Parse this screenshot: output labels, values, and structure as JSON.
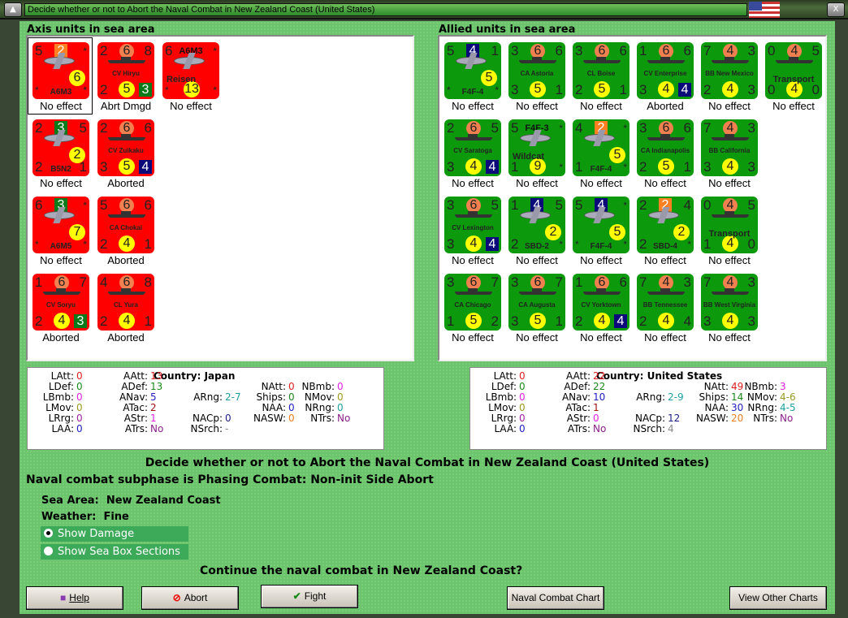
{
  "window": {
    "title": "Decide whether or not to Abort the Naval Combat in New Zealand Coast (United States)",
    "min_glyph": "▲",
    "close_glyph": "X"
  },
  "axis": {
    "header": "Axis units in sea area",
    "units": [
      {
        "kind": "plane",
        "tl": "5",
        "top": "2",
        "top_style": "sq-orange",
        "tr": "*",
        "mid": "6",
        "bl": "*",
        "br": "*",
        "name": "A6M3",
        "status": "No effect",
        "selected": true
      },
      {
        "kind": "ship",
        "tl": "2",
        "top": "6",
        "top_style": "circle",
        "tr": "8",
        "bl": "2",
        "bc": "5",
        "br": "3",
        "br_style": "sq-green",
        "name": "CV Hiryu",
        "status": "Abrt Dmgd"
      },
      {
        "kind": "plane",
        "tl": "6",
        "top": "A6M3",
        "top_style": "text",
        "tr": "*",
        "bc": "13",
        "bl": "*",
        "br": "*",
        "extra": "Reisen",
        "status": "No effect"
      },
      {
        "kind": "plane",
        "tl": "2",
        "top": "3",
        "top_style": "sq-green",
        "tr": "5",
        "mid": "2",
        "bl": "2",
        "br": "1",
        "name": "B5N2",
        "status": "No effect"
      },
      {
        "kind": "ship",
        "tl": "2",
        "top": "6",
        "top_style": "circle",
        "tr": "6",
        "bl": "3",
        "bc": "5",
        "br": "4",
        "br_style": "sq-blue",
        "name": "CV Zuikaku",
        "status": "Aborted"
      },
      {
        "kind": "plane",
        "tl": "6",
        "top": "3",
        "top_style": "sq-green",
        "tr": "*",
        "mid": "7",
        "bl": "*",
        "br": "*",
        "name": "A6M5",
        "status": "No effect"
      },
      {
        "kind": "ship",
        "tl": "5",
        "top": "6",
        "top_style": "circle",
        "tr": "6",
        "bl": "2",
        "bc": "4",
        "br": "1",
        "name": "CA Chokai",
        "status": "Aborted"
      },
      {
        "kind": "ship",
        "tl": "1",
        "top": "6",
        "top_style": "circle",
        "tr": "7",
        "bl": "2",
        "bc": "4",
        "br": "3",
        "br_style": "sq-green",
        "name": "CV Soryu",
        "status": "Aborted"
      },
      {
        "kind": "ship",
        "tl": "4",
        "top": "6",
        "top_style": "circle",
        "tr": "8",
        "bl": "2",
        "bc": "4",
        "br": "1",
        "name": "CL Yura",
        "status": "Aborted"
      }
    ],
    "stats": {
      "country_label": "Country:",
      "country": "Japan",
      "LAtt": "0",
      "LDef": "0",
      "LBmb": "0",
      "LMov": "0",
      "LRrg": "0",
      "LAA": "0",
      "AAtt": "13",
      "ADef": "13",
      "ANav": "5",
      "ATac": "2",
      "AStr": "1",
      "ATrs": "No",
      "ARng": "2-7",
      "NACp": "0",
      "NSrch": "-",
      "NAtt": "0",
      "Ships": "0",
      "NAA": "0",
      "NASW": "0",
      "NBmb": "0",
      "NMov": "0",
      "NRng": "0",
      "NTrs": "No"
    }
  },
  "allied": {
    "header": "Allied units in sea area",
    "units": [
      {
        "kind": "plane",
        "tl": "5",
        "top": "4",
        "top_style": "sq-blue",
        "tr": "1",
        "mid": "5",
        "bl": "*",
        "br": "*",
        "name": "F4F-4",
        "status": "No effect"
      },
      {
        "kind": "ship",
        "tl": "3",
        "top": "6",
        "top_style": "circle",
        "tr": "6",
        "bl": "3",
        "bc": "5",
        "br": "1",
        "name": "CA Astoria",
        "status": "No effect"
      },
      {
        "kind": "ship",
        "tl": "3",
        "top": "6",
        "top_style": "circle",
        "tr": "6",
        "bl": "2",
        "bc": "5",
        "br": "1",
        "name": "CL Boise",
        "status": "No effect"
      },
      {
        "kind": "ship",
        "tl": "1",
        "top": "6",
        "top_style": "circle",
        "tr": "6",
        "bl": "3",
        "bc": "4",
        "br": "4",
        "br_style": "sq-blue",
        "name": "CV Enterprise",
        "status": "Aborted"
      },
      {
        "kind": "ship",
        "tl": "7",
        "top": "4",
        "top_style": "circle",
        "tr": "3",
        "bl": "2",
        "bc": "4",
        "br": "3",
        "name": "BB New Mexico",
        "status": "No effect"
      },
      {
        "kind": "ship",
        "tl": "0",
        "top": "4",
        "top_style": "circle",
        "tr": "5",
        "bl": "0",
        "bc": "4",
        "br": "0",
        "extra": "Transport",
        "status": "No effect"
      },
      {
        "kind": "ship",
        "tl": "2",
        "top": "6",
        "top_style": "circle",
        "tr": "5",
        "bl": "3",
        "bc": "4",
        "br": "4",
        "br_style": "sq-blue",
        "name": "CV Saratoga",
        "status": "No effect"
      },
      {
        "kind": "plane",
        "tl": "5",
        "top": "F4F-3",
        "top_style": "text",
        "tr": "*",
        "bl": "1",
        "bc": "9",
        "br": "*",
        "extra": "Wildcat",
        "status": "No effect"
      },
      {
        "kind": "plane",
        "tl": "4",
        "top": "2",
        "top_style": "sq-orange",
        "tr": "*",
        "mid": "5",
        "bl": "1",
        "br": "*",
        "name": "F4F-4",
        "status": "No effect"
      },
      {
        "kind": "ship",
        "tl": "3",
        "top": "6",
        "top_style": "circle",
        "tr": "6",
        "bl": "2",
        "bc": "5",
        "br": "1",
        "name": "CA Indianapolis",
        "status": "No effect"
      },
      {
        "kind": "ship",
        "tl": "7",
        "top": "4",
        "top_style": "circle",
        "tr": "3",
        "bl": "3",
        "bc": "4",
        "br": "3",
        "name": "BB California",
        "status": "No effect"
      },
      {
        "kind": "ship",
        "tl": "3",
        "top": "6",
        "top_style": "circle",
        "tr": "5",
        "bl": "3",
        "bc": "4",
        "br": "4",
        "br_style": "sq-blue",
        "name": "CV Lexington",
        "status": "No effect"
      },
      {
        "kind": "plane",
        "tl": "1",
        "top": "4",
        "top_style": "sq-blue",
        "tr": "5",
        "mid": "2",
        "bl": "2",
        "br": "*",
        "name": "SBD-2",
        "status": "No effect"
      },
      {
        "kind": "plane",
        "tl": "5",
        "top": "4",
        "top_style": "sq-blue",
        "tr": "*",
        "mid": "5",
        "bl": "*",
        "br": "*",
        "name": "F4F-4",
        "status": "No effect"
      },
      {
        "kind": "plane",
        "tl": "2",
        "top": "2",
        "top_style": "sq-orange",
        "tr": "4",
        "mid": "2",
        "bl": "2",
        "br": "*",
        "name": "SBD-4",
        "status": "No effect"
      },
      {
        "kind": "ship",
        "tl": "0",
        "top": "4",
        "top_style": "circle",
        "tr": "5",
        "bl": "1",
        "bc": "4",
        "br": "0",
        "extra": "Transport",
        "status": "No effect"
      },
      {
        "kind": "ship",
        "tl": "3",
        "top": "6",
        "top_style": "circle",
        "tr": "7",
        "bl": "1",
        "bc": "5",
        "br": "2",
        "name": "CA Chicago",
        "status": "No effect"
      },
      {
        "kind": "ship",
        "tl": "3",
        "top": "6",
        "top_style": "circle",
        "tr": "7",
        "bl": "3",
        "bc": "5",
        "br": "1",
        "name": "CA Augusta",
        "status": "No effect"
      },
      {
        "kind": "ship",
        "tl": "1",
        "top": "6",
        "top_style": "circle",
        "tr": "6",
        "bl": "2",
        "bc": "4",
        "br": "4",
        "br_style": "sq-blue",
        "name": "CV Yorktown",
        "status": "No effect"
      },
      {
        "kind": "ship",
        "tl": "7",
        "top": "4",
        "top_style": "circle",
        "tr": "3",
        "bl": "2",
        "bc": "4",
        "br": "4",
        "name": "BB Tennessee",
        "status": "No effect"
      },
      {
        "kind": "ship",
        "tl": "7",
        "top": "4",
        "top_style": "circle",
        "tr": "3",
        "bl": "3",
        "bc": "4",
        "br": "3",
        "name": "BB West Virginia",
        "status": "No effect"
      }
    ],
    "stats": {
      "country_label": "Country:",
      "country": "United States",
      "LAtt": "0",
      "LDef": "0",
      "LBmb": "0",
      "LMov": "0",
      "LRrg": "0",
      "LAA": "0",
      "AAtt": "22",
      "ADef": "22",
      "ANav": "10",
      "ATac": "1",
      "AStr": "0",
      "ATrs": "No",
      "ARng": "2-9",
      "NACp": "12",
      "NSrch": "4",
      "NAtt": "49",
      "Ships": "14",
      "NAA": "30",
      "NASW": "20",
      "NBmb": "3",
      "NMov": "4-6",
      "NRng": "4-5",
      "NTrs": "No"
    }
  },
  "stat_colors": {
    "LAtt": "#e02020",
    "LDef": "#1a8a1a",
    "LBmb": "#e020e0",
    "LMov": "#9a9a20",
    "LRrg": "#a020a0",
    "LAA": "#2020c0",
    "AAtt": "#e02020",
    "ADef": "#1a8a1a",
    "ANav": "#2020c0",
    "ATac": "#a01010",
    "AStr": "#e020e0",
    "ATrs": "#8a208a",
    "ARng": "#20a0a0",
    "NACp": "#20208a",
    "NSrch": "#888888",
    "NAtt": "#e02020",
    "Ships": "#1a8a1a",
    "NAA": "#2020c0",
    "NASW": "#f08020",
    "NBmb": "#e020e0",
    "NMov": "#9a9a20",
    "NRng": "#20a0a0",
    "NTrs": "#8a208a"
  },
  "messages": {
    "heading": "Decide whether or not to Abort the Naval Combat in New Zealand Coast (United States)",
    "subphase": "Naval combat subphase is Phasing Combat: Non-init Side Abort",
    "sea_area_label": "Sea Area:",
    "sea_area": "New Zealand Coast",
    "weather_label": "Weather:",
    "weather": "Fine",
    "question": "Continue the naval combat in New Zealand Coast?"
  },
  "options": [
    {
      "label": "Show Damage",
      "checked": true
    },
    {
      "label": "Show Sea Box Sections",
      "checked": false
    }
  ],
  "buttons": {
    "help": "Help",
    "abort": "Abort",
    "fight": "Fight",
    "naval_chart": "Naval Combat Chart",
    "other_charts": "View Other Charts"
  }
}
